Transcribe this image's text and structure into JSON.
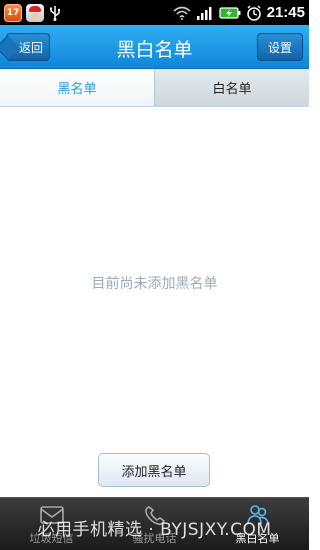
{
  "status_bar": {
    "badge_left": "17",
    "clock": "21:45",
    "icons": [
      "calendar-badge-icon",
      "santa-app-icon",
      "usb-icon",
      "wifi-icon",
      "signal-icon",
      "battery-charging-icon",
      "alarm-clock-icon"
    ]
  },
  "header": {
    "title": "黑白名单",
    "back_label": "返回",
    "settings_label": "设置"
  },
  "tabs": [
    {
      "label": "黑名单",
      "active": true
    },
    {
      "label": "白名单",
      "active": false
    }
  ],
  "main": {
    "empty_message": "目前尚未添加黑名单",
    "add_button_label": "添加黑名单"
  },
  "bottom_nav": {
    "items": [
      {
        "label": "垃圾短信",
        "icon": "envelope-icon",
        "active": false
      },
      {
        "label": "骚扰电话",
        "icon": "phone-icon",
        "active": false
      },
      {
        "label": "黑白名单",
        "icon": "contacts-icon",
        "active": true
      }
    ]
  },
  "watermark": "必用手机精选 · BYJSJXY.COM",
  "colors": {
    "header_blue": "#1e9ce6",
    "tab_active_text": "#2a9be3",
    "empty_text": "#9aaab6",
    "nav_bg": "#1b1b1b"
  }
}
